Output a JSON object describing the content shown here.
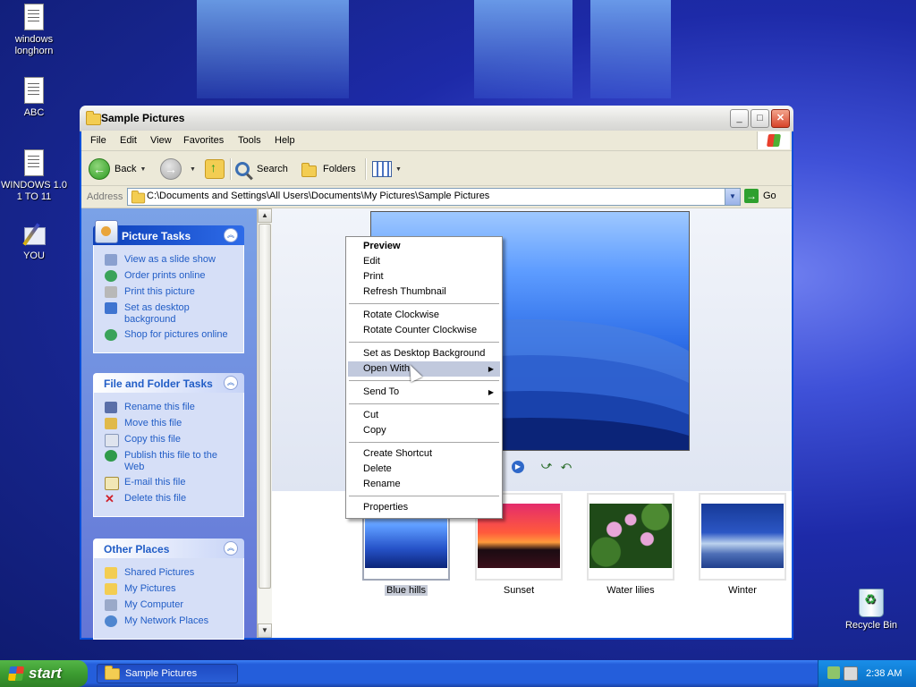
{
  "desktop": {
    "icons": [
      {
        "label": "windows longhorn"
      },
      {
        "label": "ABC"
      },
      {
        "label": "WINDOWS 1.0 1 TO 11"
      },
      {
        "label": "YOU"
      },
      {
        "label": "Recycle Bin"
      }
    ]
  },
  "window": {
    "title": "Sample Pictures",
    "menu": [
      "File",
      "Edit",
      "View",
      "Favorites",
      "Tools",
      "Help"
    ],
    "toolbar": {
      "back": "Back",
      "search": "Search",
      "folders": "Folders"
    },
    "address": {
      "label": "Address",
      "path": "C:\\Documents and Settings\\All Users\\Documents\\My Pictures\\Sample Pictures",
      "go": "Go"
    }
  },
  "taskpane": {
    "picture_tasks": {
      "title": "Picture Tasks",
      "items": [
        "View as a slide show",
        "Order prints online",
        "Print this picture",
        "Set as desktop background",
        "Shop for pictures online"
      ]
    },
    "file_tasks": {
      "title": "File and Folder Tasks",
      "items": [
        "Rename this file",
        "Move this file",
        "Copy this file",
        "Publish this file to the Web",
        "E-mail this file",
        "Delete this file"
      ]
    },
    "other_places": {
      "title": "Other Places",
      "items": [
        "Shared Pictures",
        "My Pictures",
        "My Computer",
        "My Network Places"
      ]
    }
  },
  "thumbnails": [
    {
      "label": "Blue hills",
      "selected": true
    },
    {
      "label": "Sunset"
    },
    {
      "label": "Water lilies"
    },
    {
      "label": "Winter"
    }
  ],
  "context_menu": {
    "items": [
      "Preview",
      "Edit",
      "Print",
      "Refresh Thumbnail",
      "Rotate Clockwise",
      "Rotate Counter Clockwise",
      "Set as Desktop Background",
      "Open With",
      "Send To",
      "Cut",
      "Copy",
      "Create Shortcut",
      "Delete",
      "Rename",
      "Properties"
    ]
  },
  "taskbar": {
    "start": "start",
    "task": "Sample Pictures",
    "clock": "2:38 AM"
  },
  "colors": {
    "accent_blue": "#215dc6",
    "title_bar": "#e3e3e0",
    "taskbar_blue": "#245edb",
    "start_green": "#3c9c31",
    "menu_hover": "#c1c9dd"
  }
}
